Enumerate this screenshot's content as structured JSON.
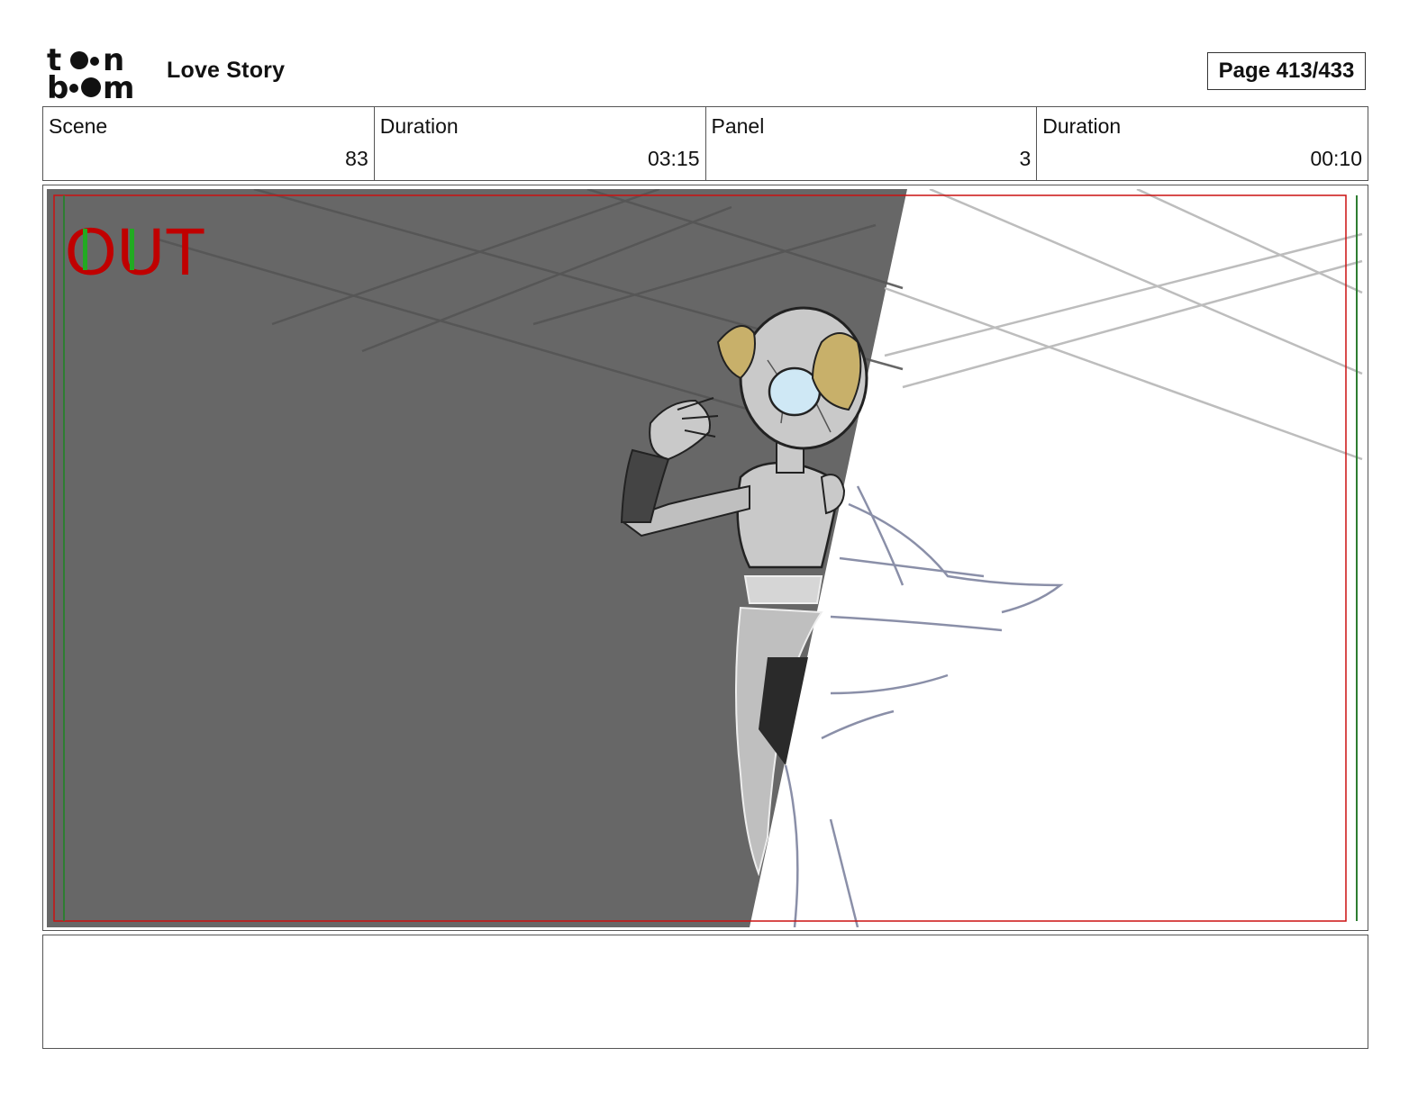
{
  "header": {
    "logo_text_top": "toon",
    "logo_text_bottom": "boom",
    "project_title": "Love Story",
    "page_label": "Page 413/433"
  },
  "info": [
    {
      "label": "Scene",
      "value": "83"
    },
    {
      "label": "Duration",
      "value": "03:15"
    },
    {
      "label": "Panel",
      "value": "3"
    },
    {
      "label": "Duration",
      "value": "00:10"
    }
  ],
  "panel": {
    "overlay_text": "OUT",
    "overlay_text_color": "#c00000",
    "overlay_accent_color": "#22aa22",
    "bg_dark": "#676767",
    "bg_light": "#ffffff",
    "safe_frame_color": "#cc1111",
    "title_safe_color": "#2e7d32"
  },
  "notes": {
    "text": ""
  }
}
